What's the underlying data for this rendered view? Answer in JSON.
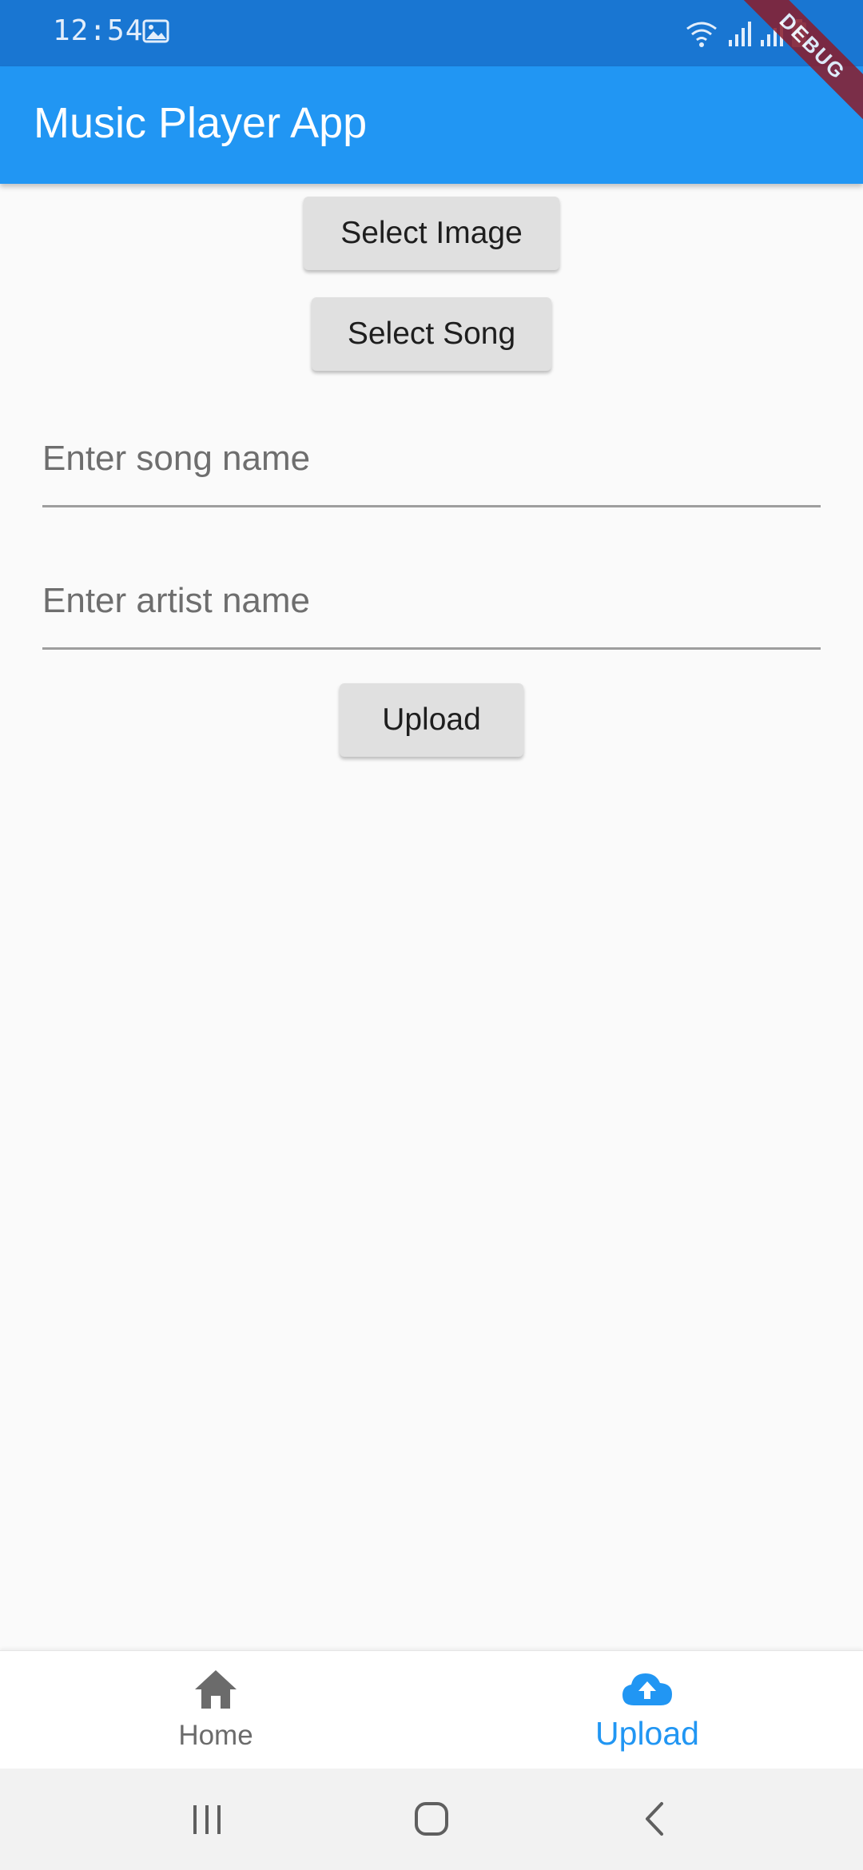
{
  "status_bar": {
    "time": "12:54",
    "left_icons": [
      "gallery-icon"
    ],
    "right_icons": [
      "wifi-icon",
      "signal-icon",
      "signal-icon",
      "battery-icon"
    ],
    "background": "#1976d2"
  },
  "debug_banner": {
    "label": "DEBUG",
    "color": "#8a1c2b"
  },
  "app_bar": {
    "title": "Music Player App",
    "color": "#2196f3"
  },
  "form": {
    "select_image_label": "Select Image",
    "select_song_label": "Select Song",
    "song_name": {
      "value": "",
      "placeholder": "Enter song name"
    },
    "artist_name": {
      "value": "",
      "placeholder": "Enter artist name"
    },
    "upload_label": "Upload"
  },
  "bottom_nav": {
    "items": [
      {
        "label": "Home",
        "icon": "home-icon",
        "selected": false
      },
      {
        "label": "Upload",
        "icon": "cloud-upload-icon",
        "selected": true
      }
    ],
    "selected_color": "#2196f3",
    "unselected_color": "#6b6b6b"
  },
  "system_nav": {
    "buttons": [
      "recents-icon",
      "home-circle-icon",
      "back-icon"
    ]
  }
}
